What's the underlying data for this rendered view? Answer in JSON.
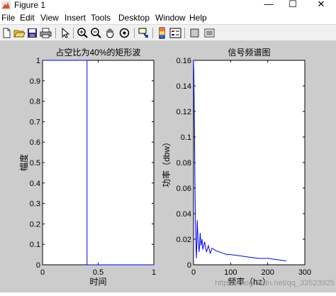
{
  "window": {
    "title": "Figure 1",
    "minimize": "—",
    "maximize": "☐",
    "close": "✕"
  },
  "menu": [
    "File",
    "Edit",
    "View",
    "Insert",
    "Tools",
    "Desktop",
    "Window",
    "Help"
  ],
  "toolbar_icons": [
    "new-file-icon",
    "open-folder-icon",
    "save-icon",
    "print-icon",
    "arrow-pointer-icon",
    "zoom-in-icon",
    "zoom-out-icon",
    "pan-hand-icon",
    "rotate-3d-icon",
    "data-cursor-icon",
    "colorbar-icon",
    "legend-icon",
    "hide-plot-tools-icon",
    "show-plot-tools-icon"
  ],
  "watermark": "https://blog.csdn.net/qq_33523925",
  "colors": {
    "figure_bg": "#cccccc",
    "axes_bg": "#ffffff",
    "line": "#0000ff"
  },
  "chart_data": [
    {
      "type": "line",
      "title": "占空比为40%的矩形波",
      "xlabel": "时间",
      "ylabel": "幅度",
      "xlim": [
        0,
        1
      ],
      "ylim": [
        0,
        1
      ],
      "xticks": [
        "0",
        "0.5",
        "1"
      ],
      "yticks": [
        "0",
        "0.1",
        "0.2",
        "0.3",
        "0.4",
        "0.5",
        "0.6",
        "0.7",
        "0.8",
        "0.9",
        "1"
      ],
      "series": [
        {
          "x": [
            0,
            0.4,
            0.4,
            1
          ],
          "y": [
            1,
            1,
            0,
            0
          ]
        }
      ]
    },
    {
      "type": "line",
      "title": "信号频谱图",
      "xlabel": "频率（hz）",
      "ylabel": "功率（dbw）",
      "xlim": [
        0,
        300
      ],
      "ylim": [
        0,
        0.16
      ],
      "xticks": [
        "0",
        "100",
        "200",
        "300"
      ],
      "yticks": [
        "0",
        "0.02",
        "0.04",
        "0.06",
        "0.08",
        "0.1",
        "0.12",
        "0.14",
        "0.16"
      ],
      "series": [
        {
          "x": [
            0,
            1,
            2,
            3,
            4,
            5,
            6,
            7,
            8,
            10,
            12,
            15,
            18,
            20,
            23,
            25,
            30,
            35,
            40,
            45,
            50,
            60,
            70,
            80,
            90,
            100,
            125,
            150,
            175,
            200,
            225,
            250
          ],
          "y": [
            0.16,
            0.15,
            0.12,
            0.09,
            0.06,
            0.035,
            0.02,
            0.01,
            0.005,
            0.035,
            0.02,
            0.01,
            0.025,
            0.015,
            0.02,
            0.012,
            0.018,
            0.01,
            0.015,
            0.009,
            0.013,
            0.011,
            0.01,
            0.009,
            0.008,
            0.008,
            0.007,
            0.006,
            0.005,
            0.005,
            0.004,
            0.003
          ]
        }
      ]
    }
  ]
}
